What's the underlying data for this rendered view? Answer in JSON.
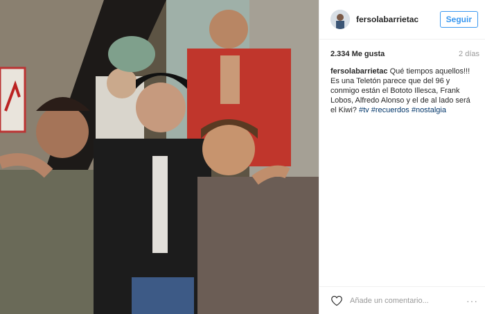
{
  "post": {
    "username": "fersolabarrietac",
    "follow_label": "Seguir",
    "likes": "2.334 Me gusta",
    "time": "2 días",
    "caption_user": "fersolabarrietac",
    "caption_text": " Qué tiempos aquellos!!! Es una Teletón parece que del 96 y conmigo están el Bototo Illesca, Frank Lobos, Alfredo Alonso y el de al lado será el Kiwi? ",
    "hashtags": [
      "#tv",
      "#recuerdos",
      "#nostalgia"
    ]
  },
  "comment": {
    "placeholder": "Añade un comentario...",
    "more": "···"
  }
}
